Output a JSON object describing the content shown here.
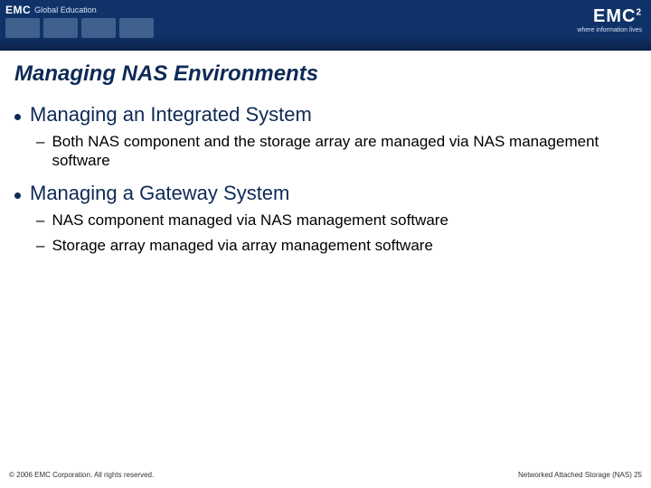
{
  "header": {
    "logo_small": "EMC",
    "global_ed": "Global Education",
    "logo_big": "EMC",
    "logo_exp": "2",
    "tagline": "where information lives"
  },
  "title": "Managing NAS Environments",
  "bullets": [
    {
      "text": "Managing an Integrated System",
      "sub": [
        "Both NAS component and the storage array are managed via NAS management software"
      ]
    },
    {
      "text": "Managing a Gateway System",
      "sub": [
        "NAS component managed via NAS management software",
        "Storage array managed via array management software"
      ]
    }
  ],
  "footer": {
    "copyright": "© 2006 EMC Corporation. All rights reserved.",
    "page_label": "Networked Attached Storage (NAS)",
    "page_num": "25"
  }
}
